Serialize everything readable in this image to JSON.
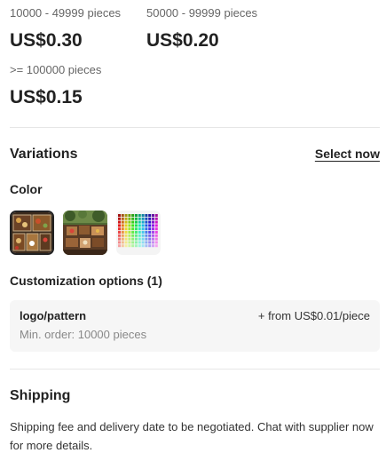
{
  "price_tiers": [
    {
      "range": "10000 - 49999 pieces",
      "price": "US$0.30"
    },
    {
      "range": "50000 - 99999 pieces",
      "price": "US$0.20"
    },
    {
      "range": ">= 100000 pieces",
      "price": "US$0.15"
    }
  ],
  "variations": {
    "title": "Variations",
    "select_label": "Select now",
    "color_label": "Color",
    "swatches": [
      {
        "name": "bento-box-swatch",
        "selected": true
      },
      {
        "name": "outdoor-picnic-swatch",
        "selected": false
      },
      {
        "name": "color-palette-swatch",
        "selected": false
      }
    ]
  },
  "customization": {
    "title": "Customization options (1)",
    "option_name": "logo/pattern",
    "option_price": "+ from US$0.01/piece",
    "option_min_order": "Min. order: 10000 pieces"
  },
  "shipping": {
    "title": "Shipping",
    "text": "Shipping fee and delivery date to be negotiated. Chat with supplier now for more details."
  }
}
